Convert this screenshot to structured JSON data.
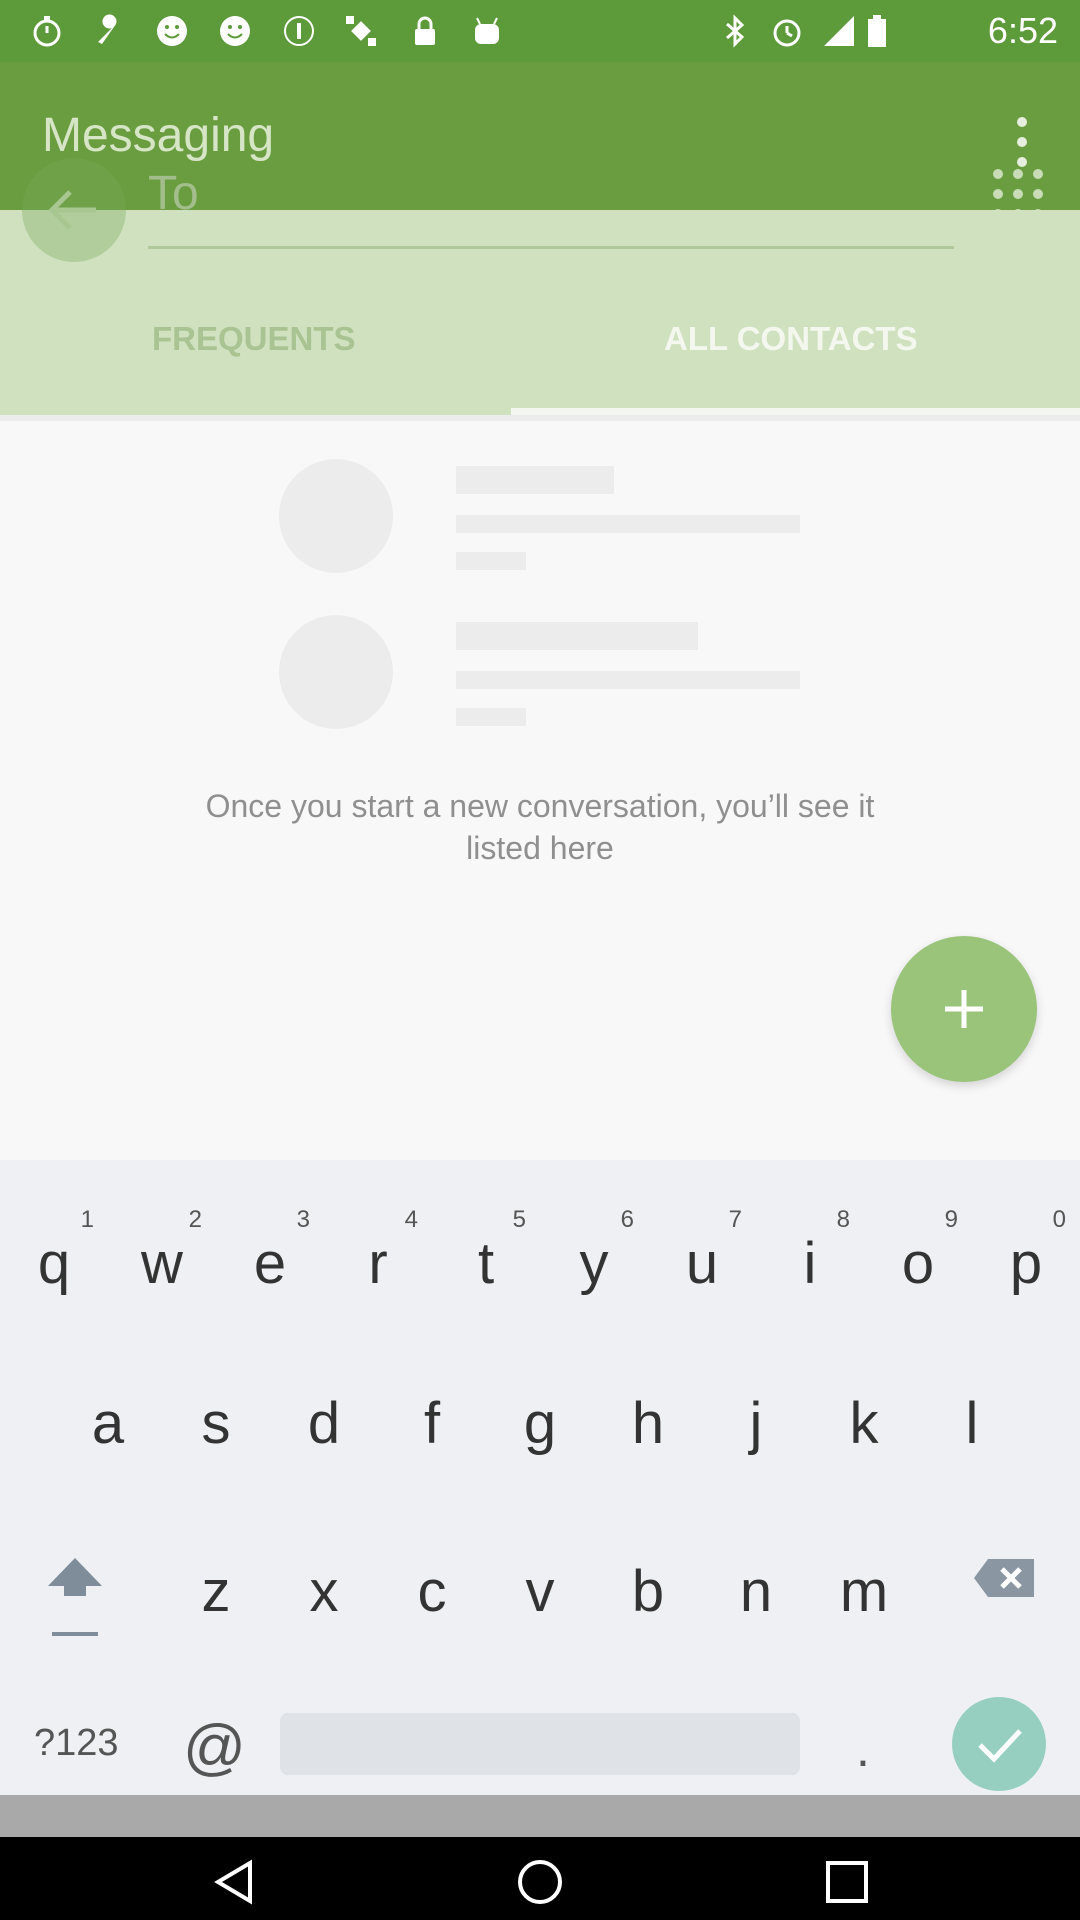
{
  "status_bar": {
    "time": "6:52",
    "left_icons": [
      "stopwatch-icon",
      "wrench-icon",
      "smiley-icon",
      "smiley-icon",
      "podcast-icon",
      "satellite-icon",
      "lock-icon",
      "android-icon"
    ],
    "right_icons": [
      "bluetooth-icon",
      "alarm-icon",
      "signal-icon",
      "battery-icon"
    ]
  },
  "app_bar": {
    "title": "Messaging"
  },
  "compose": {
    "to_placeholder": "To",
    "tabs": [
      {
        "label": "FREQUENTS",
        "selected": false
      },
      {
        "label": "ALL CONTACTS",
        "selected": true
      }
    ]
  },
  "empty_state": {
    "line1": "Once you start a new conversation, you’ll see it",
    "line2": "listed here"
  },
  "fab": {
    "icon": "plus-icon"
  },
  "keyboard": {
    "row1": [
      {
        "ch": "q",
        "num": "1"
      },
      {
        "ch": "w",
        "num": "2"
      },
      {
        "ch": "e",
        "num": "3"
      },
      {
        "ch": "r",
        "num": "4"
      },
      {
        "ch": "t",
        "num": "5"
      },
      {
        "ch": "y",
        "num": "6"
      },
      {
        "ch": "u",
        "num": "7"
      },
      {
        "ch": "i",
        "num": "8"
      },
      {
        "ch": "o",
        "num": "9"
      },
      {
        "ch": "p",
        "num": "0"
      }
    ],
    "row2": [
      "a",
      "s",
      "d",
      "f",
      "g",
      "h",
      "j",
      "k",
      "l"
    ],
    "row3": [
      "z",
      "x",
      "c",
      "v",
      "b",
      "n",
      "m"
    ],
    "symbols_label": "?123",
    "at_label": "@",
    "period_label": "."
  },
  "colors": {
    "status_bar": "#5d9a3a",
    "app_bar": "#6a9d3f",
    "compose_bg": "#cfe1bf",
    "fab": "#9bc47b",
    "enter": "#96cfc0"
  }
}
